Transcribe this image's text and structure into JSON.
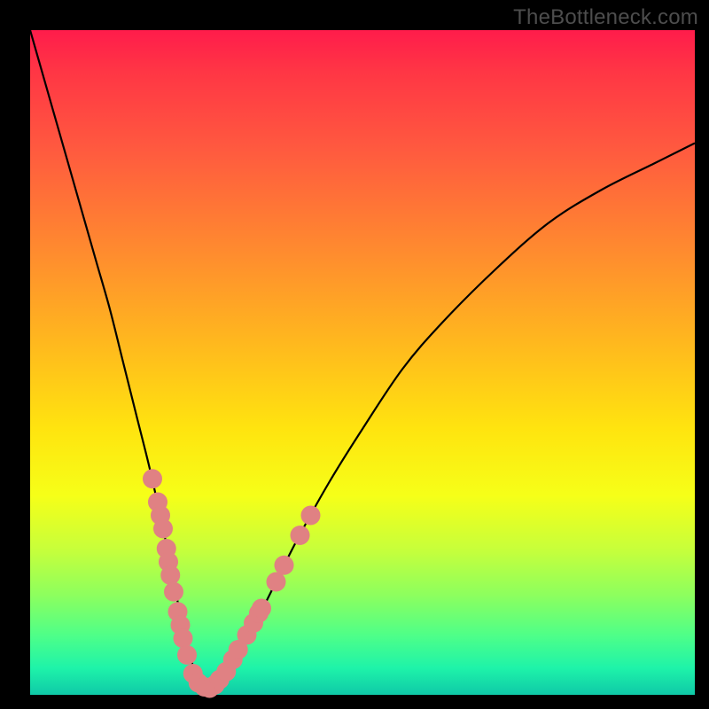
{
  "watermark": "TheBottleneck.com",
  "chart_data": {
    "type": "line",
    "title": "",
    "xlabel": "",
    "ylabel": "",
    "xlim": [
      0,
      100
    ],
    "ylim": [
      0,
      100
    ],
    "grid": false,
    "legend": false,
    "series": [
      {
        "name": "bottleneck-curve",
        "x": [
          0,
          2,
          4,
          6,
          8,
          10,
          12,
          14,
          16,
          18,
          20,
          21,
          22,
          23,
          24,
          25,
          26,
          27,
          28,
          30,
          33,
          36,
          40,
          45,
          50,
          56,
          62,
          70,
          78,
          86,
          94,
          100
        ],
        "y": [
          100,
          93,
          86,
          79,
          72,
          65,
          58,
          50,
          42,
          34,
          25,
          20,
          15,
          10,
          6,
          3,
          1.5,
          1,
          1.5,
          4,
          9,
          15,
          23,
          32,
          40,
          49,
          56,
          64,
          71,
          76,
          80,
          83
        ]
      }
    ],
    "markers": {
      "name": "sample-dots",
      "points": [
        {
          "x": 18.4,
          "y": 32.5
        },
        {
          "x": 19.2,
          "y": 29.0
        },
        {
          "x": 19.6,
          "y": 27.0
        },
        {
          "x": 20.0,
          "y": 25.0
        },
        {
          "x": 20.5,
          "y": 22.0
        },
        {
          "x": 20.8,
          "y": 20.0
        },
        {
          "x": 21.1,
          "y": 18.0
        },
        {
          "x": 21.6,
          "y": 15.5
        },
        {
          "x": 22.2,
          "y": 12.5
        },
        {
          "x": 22.6,
          "y": 10.5
        },
        {
          "x": 23.0,
          "y": 8.5
        },
        {
          "x": 23.6,
          "y": 6.0
        },
        {
          "x": 24.5,
          "y": 3.2
        },
        {
          "x": 25.3,
          "y": 1.8
        },
        {
          "x": 26.2,
          "y": 1.2
        },
        {
          "x": 27.0,
          "y": 1.0
        },
        {
          "x": 27.8,
          "y": 1.5
        },
        {
          "x": 28.5,
          "y": 2.3
        },
        {
          "x": 29.5,
          "y": 3.5
        },
        {
          "x": 30.5,
          "y": 5.3
        },
        {
          "x": 31.3,
          "y": 6.8
        },
        {
          "x": 32.6,
          "y": 9.0
        },
        {
          "x": 33.6,
          "y": 10.8
        },
        {
          "x": 34.4,
          "y": 12.3
        },
        {
          "x": 34.8,
          "y": 13.0
        },
        {
          "x": 37.0,
          "y": 17.0
        },
        {
          "x": 38.2,
          "y": 19.5
        },
        {
          "x": 40.6,
          "y": 24.0
        },
        {
          "x": 42.2,
          "y": 27.0
        }
      ]
    }
  }
}
